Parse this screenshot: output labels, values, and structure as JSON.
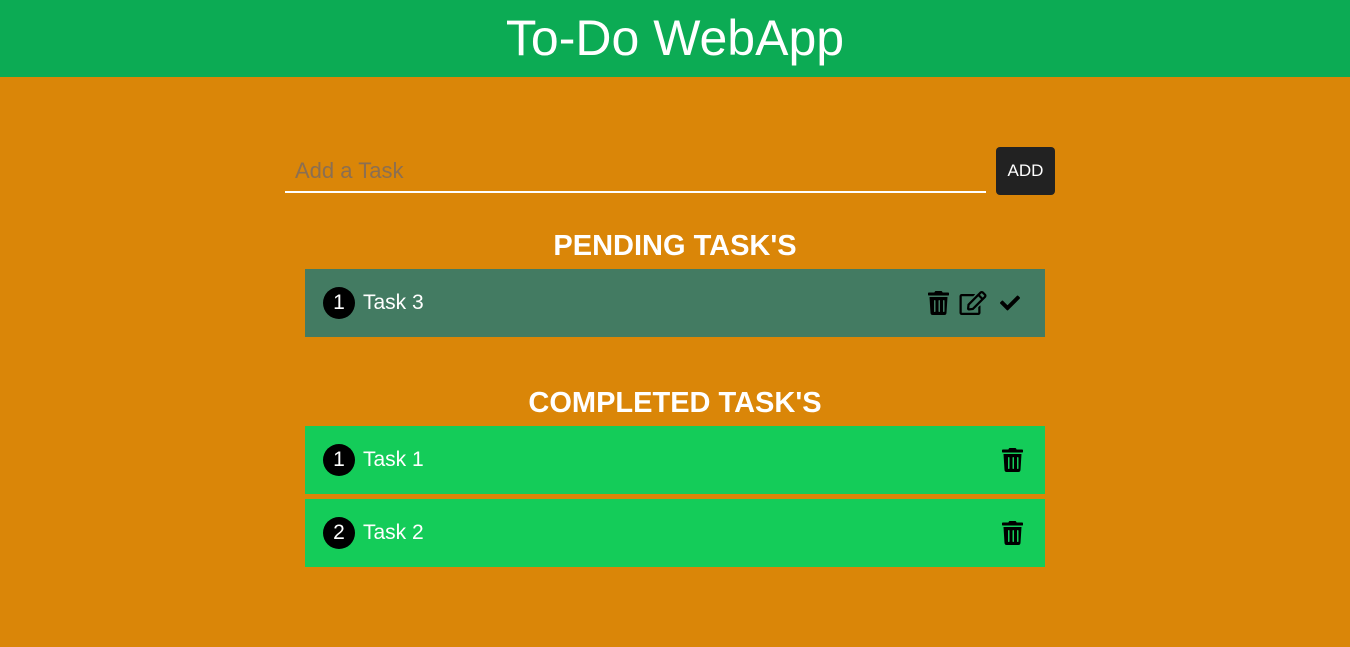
{
  "header": {
    "title": "To-Do WebApp"
  },
  "input": {
    "placeholder": "Add a Task",
    "value": ""
  },
  "add_button": {
    "label": "ADD"
  },
  "pending": {
    "title": "PENDING TASK'S",
    "tasks": [
      {
        "number": "1",
        "text": "Task 3",
        "actions": [
          "trash-icon",
          "edit-icon",
          "check-icon"
        ]
      }
    ]
  },
  "completed": {
    "title": "COMPLETED TASK'S",
    "tasks": [
      {
        "number": "1",
        "text": "Task 1",
        "actions": [
          "trash-icon"
        ]
      },
      {
        "number": "2",
        "text": "Task 2",
        "actions": [
          "trash-icon"
        ]
      }
    ]
  },
  "colors": {
    "background": "#da8608",
    "header": "#0cab54",
    "pending_row": "#437b62",
    "completed_row": "#14cc59",
    "button": "#222222"
  }
}
